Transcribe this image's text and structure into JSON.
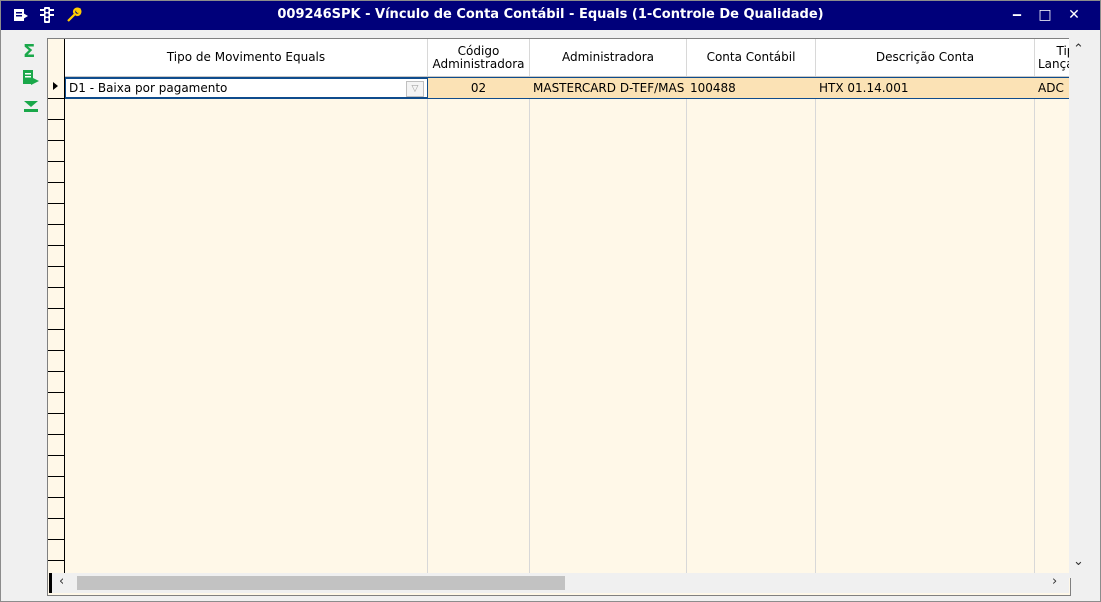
{
  "window": {
    "title": "009246SPK - Vínculo de Conta Contábil - Equals (1-Controle De Qualidade)",
    "controls": [
      "minimize-icon",
      "maximize-icon",
      "close-icon"
    ],
    "title_icons": [
      "menu-icon",
      "traffic-light-icon",
      "wrench-icon"
    ]
  },
  "sidebar": {
    "tools": [
      "sum-icon",
      "export-icon",
      "filter-down-icon"
    ]
  },
  "grid": {
    "columns": [
      {
        "key": "tipo",
        "label": "Tipo de Movimento Equals"
      },
      {
        "key": "codigo",
        "label": "Código\nAdministradora"
      },
      {
        "key": "admin",
        "label": "Administradora"
      },
      {
        "key": "conta",
        "label": "Conta Contábil"
      },
      {
        "key": "desc",
        "label": "Descrição Conta"
      },
      {
        "key": "tipo_lanc",
        "label": "Tipo\nLançamen"
      }
    ],
    "rows": [
      {
        "tipo": "D1 - Baixa por pagamento",
        "codigo": "02",
        "admin": "MASTERCARD D-TEF/MAS",
        "conta": "100488",
        "desc": "HTX 01.14.001",
        "tipo_lanc": "ADC"
      }
    ]
  },
  "colors": {
    "titlebar": "#00007a",
    "grid_background": "#fff8e8",
    "selected_row": "#fbe2b5",
    "accent_green": "#1aa84a"
  }
}
